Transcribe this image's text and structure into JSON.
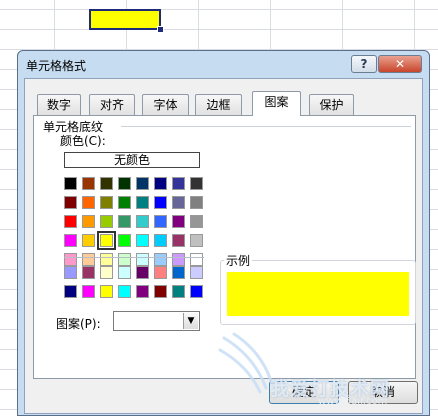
{
  "dialog": {
    "title": "单元格格式",
    "help_label": "?",
    "close_label": "✕"
  },
  "tabs": [
    {
      "label": "数字",
      "active": false
    },
    {
      "label": "对齐",
      "active": false
    },
    {
      "label": "字体",
      "active": false
    },
    {
      "label": "边框",
      "active": false
    },
    {
      "label": "图案",
      "active": true
    },
    {
      "label": "保护",
      "active": false
    }
  ],
  "shading": {
    "group_label": "单元格底纹",
    "color_label": "颜色(C):",
    "no_color_label": "无颜色",
    "selected_color": "#ffff00",
    "palette_main": [
      [
        "#000000",
        "#993300",
        "#333300",
        "#003300",
        "#003366",
        "#000080",
        "#333399",
        "#333333"
      ],
      [
        "#800000",
        "#ff6600",
        "#808000",
        "#008000",
        "#008080",
        "#0000ff",
        "#666699",
        "#808080"
      ],
      [
        "#ff0000",
        "#ff9900",
        "#99cc00",
        "#339966",
        "#33cccc",
        "#3366ff",
        "#800080",
        "#969696"
      ],
      [
        "#ff00ff",
        "#ffcc00",
        "#ffff00",
        "#00ff00",
        "#00ffff",
        "#00ccff",
        "#993366",
        "#c0c0c0"
      ],
      [
        "#ff99cc",
        "#ffcc99",
        "#ffff99",
        "#ccffcc",
        "#ccffff",
        "#99ccff",
        "#cc99ff",
        "#ffffff"
      ]
    ],
    "palette_extra": [
      [
        "#9999ff",
        "#993366",
        "#ffffcc",
        "#ccffff",
        "#660066",
        "#ff8080",
        "#0066cc",
        "#ccccff"
      ],
      [
        "#000080",
        "#ff00ff",
        "#ffff00",
        "#00ffff",
        "#800080",
        "#800000",
        "#008080",
        "#0000ff"
      ]
    ],
    "pattern_label": "图案(P):",
    "pattern_value": "",
    "sample_label": "示例"
  },
  "buttons": {
    "ok_label": "确定",
    "cancel_label": "取消"
  },
  "watermark": {
    "text": "我爱打技术网",
    "url": "www.5ajf.com"
  },
  "colors": {
    "cell_fill": "#ffff00",
    "dialog_frame": "#c6dcf1"
  }
}
